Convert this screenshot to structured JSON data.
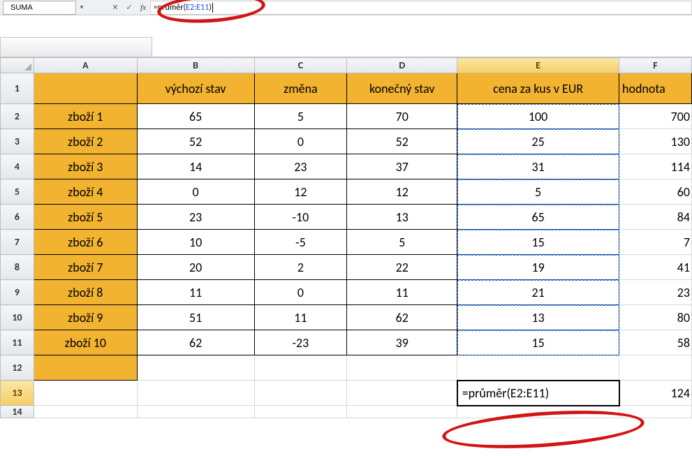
{
  "name_box": "SUMA",
  "formula_plain_prefix": "=průměr(",
  "formula_ref": "E2:E11",
  "formula_plain_suffix": ")",
  "col_headers": [
    "A",
    "B",
    "C",
    "D",
    "E",
    "F"
  ],
  "row_headers": [
    "1",
    "2",
    "3",
    "4",
    "5",
    "6",
    "7",
    "8",
    "9",
    "10",
    "11",
    "12",
    "13",
    "14"
  ],
  "header_row": [
    "",
    "výchozí stav",
    "změna",
    "konečný stav",
    "cena za kus v EUR",
    "hodnota"
  ],
  "rows": [
    {
      "label": "zboží 1",
      "b": "65",
      "c": "5",
      "d": "70",
      "e": "100",
      "f": "700"
    },
    {
      "label": "zboží 2",
      "b": "52",
      "c": "0",
      "d": "52",
      "e": "25",
      "f": "130"
    },
    {
      "label": "zboží 3",
      "b": "14",
      "c": "23",
      "d": "37",
      "e": "31",
      "f": "114"
    },
    {
      "label": "zboží 4",
      "b": "0",
      "c": "12",
      "d": "12",
      "e": "5",
      "f": "60"
    },
    {
      "label": "zboží 5",
      "b": "23",
      "c": "-10",
      "d": "13",
      "e": "65",
      "f": "84"
    },
    {
      "label": "zboží 6",
      "b": "10",
      "c": "-5",
      "d": "5",
      "e": "15",
      "f": "7"
    },
    {
      "label": "zboží 7",
      "b": "20",
      "c": "2",
      "d": "22",
      "e": "19",
      "f": "41"
    },
    {
      "label": "zboží 8",
      "b": "11",
      "c": "0",
      "d": "11",
      "e": "21",
      "f": "23"
    },
    {
      "label": "zboží 9",
      "b": "51",
      "c": "11",
      "d": "62",
      "e": "13",
      "f": "80"
    },
    {
      "label": "zboží 10",
      "b": "62",
      "c": "-23",
      "d": "39",
      "e": "15",
      "f": "58"
    }
  ],
  "formula_cell_text": "=průměr(E2:E11)",
  "f13_value": "124",
  "icons": {
    "dropdown": "▾",
    "cancel": "✕",
    "enter": "✓",
    "fx": "fx"
  }
}
